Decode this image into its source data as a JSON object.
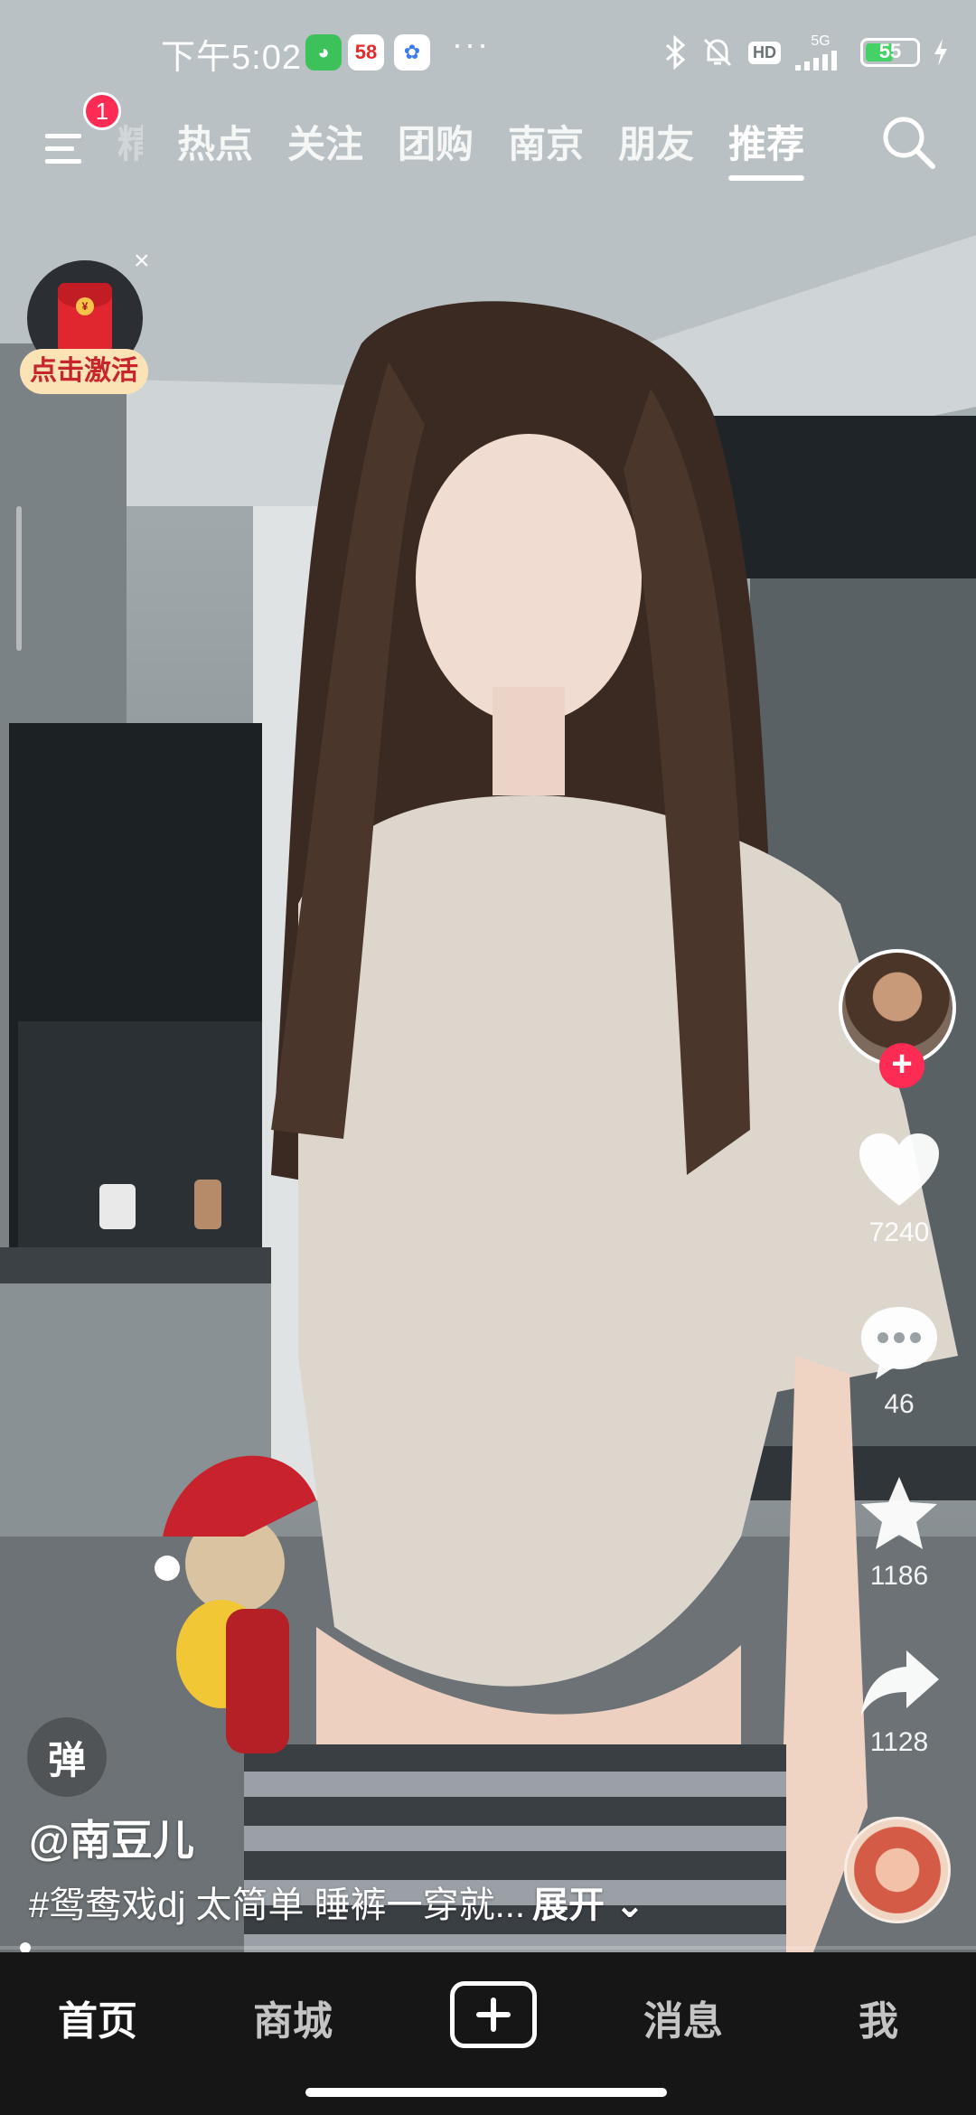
{
  "status_bar": {
    "time": "下午5:02",
    "app_icons": [
      {
        "name": "wechat-like-icon",
        "label": ""
      },
      {
        "name": "58-app-icon",
        "label": "58"
      },
      {
        "name": "cloud-app-icon",
        "label": ""
      }
    ],
    "more": "···",
    "network": "5G",
    "hd": "HD",
    "battery": "55"
  },
  "top_nav": {
    "menu_badge": "1",
    "tabs": [
      "热点",
      "关注",
      "团购",
      "南京",
      "朋友",
      "推荐"
    ],
    "ghost_tab": "精选",
    "active_tab": "推荐"
  },
  "red_packet": {
    "label": "点击激活",
    "close": "×",
    "coin": "¥"
  },
  "actions": {
    "likes": "7240",
    "comments": "46",
    "favorites": "1186",
    "shares": "1128"
  },
  "video": {
    "danmu_label": "弹",
    "author": "@南豆儿",
    "caption": "#鸳鸯戏dj 太简单 睡裤一穿就...",
    "expand": "展开",
    "progress": 0.02
  },
  "bottom_nav": {
    "home": "首页",
    "mall": "商城",
    "messages": "消息",
    "me": "我"
  },
  "colors": {
    "accent": "#fe2c55",
    "battery": "#44d165",
    "nav_bg": "#161616"
  }
}
